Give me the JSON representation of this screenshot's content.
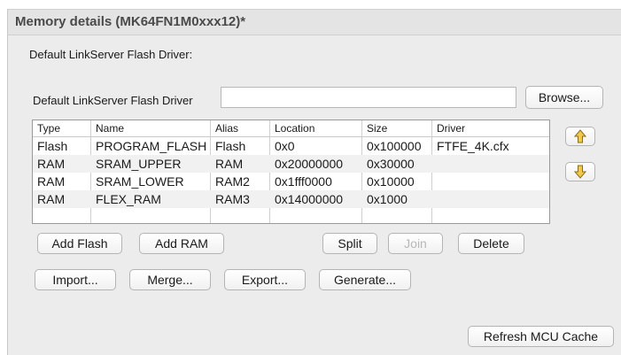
{
  "title": "Memory details (MK64FN1M0xxx12)*",
  "driver_section_label": "Default LinkServer Flash Driver:",
  "driver_field_label": "Default LinkServer Flash Driver",
  "driver_field_value": "",
  "browse_label": "Browse...",
  "table": {
    "headers": {
      "type": "Type",
      "name": "Name",
      "alias": "Alias",
      "location": "Location",
      "size": "Size",
      "driver": "Driver"
    },
    "rows": [
      {
        "type": "Flash",
        "name": "PROGRAM_FLASH",
        "alias": "Flash",
        "location": "0x0",
        "size": "0x100000",
        "driver": "FTFE_4K.cfx"
      },
      {
        "type": "RAM",
        "name": "SRAM_UPPER",
        "alias": "RAM",
        "location": "0x20000000",
        "size": "0x30000",
        "driver": ""
      },
      {
        "type": "RAM",
        "name": "SRAM_LOWER",
        "alias": "RAM2",
        "location": "0x1fff0000",
        "size": "0x10000",
        "driver": ""
      },
      {
        "type": "RAM",
        "name": "FLEX_RAM",
        "alias": "RAM3",
        "location": "0x14000000",
        "size": "0x1000",
        "driver": ""
      }
    ]
  },
  "buttons": {
    "add_flash": "Add Flash",
    "add_ram": "Add RAM",
    "split": "Split",
    "join": "Join",
    "delete": "Delete",
    "import": "Import...",
    "merge": "Merge...",
    "export": "Export...",
    "generate": "Generate...",
    "refresh": "Refresh MCU Cache"
  },
  "icons": {
    "move_up": "arrow-up-icon",
    "move_down": "arrow-down-icon"
  },
  "colors": {
    "panel_bg": "#ececec",
    "arrow_fill": "#f2c94c"
  }
}
